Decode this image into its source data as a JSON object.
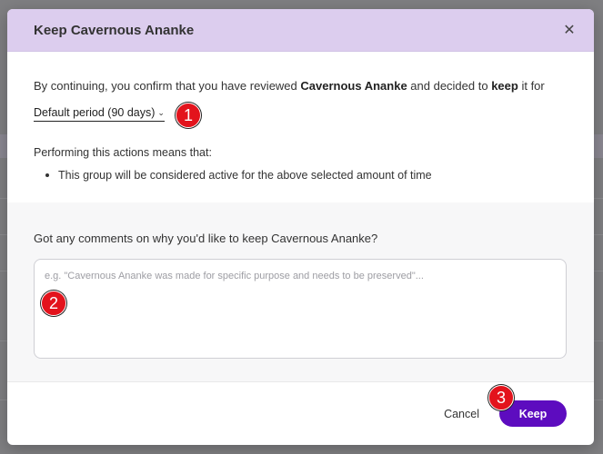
{
  "dialog": {
    "title": "Keep Cavernous Ananke",
    "close_icon": "close-icon",
    "confirm_prefix": "By continuing, you confirm that you have reviewed ",
    "group_name": "Cavernous Ananke",
    "confirm_middle": " and decided to ",
    "action_word": "keep",
    "confirm_suffix": " it for",
    "period_label": "Default period (90 days)",
    "means_heading": "Performing this actions means that:",
    "bullets": [
      "This group will be considered active for the above selected amount of time"
    ],
    "comment_label": "Got any comments on why you'd like to keep Cavernous Ananke?",
    "comment_placeholder": "e.g. \"Cavernous Ananke was made for specific purpose and needs to be preserved\"...",
    "comment_value": "",
    "cancel_label": "Cancel",
    "keep_label": "Keep"
  },
  "markers": [
    "1",
    "2",
    "3"
  ],
  "colors": {
    "header_bg": "#dccdee",
    "primary": "#5d0cbf",
    "marker": "#e3131c"
  }
}
